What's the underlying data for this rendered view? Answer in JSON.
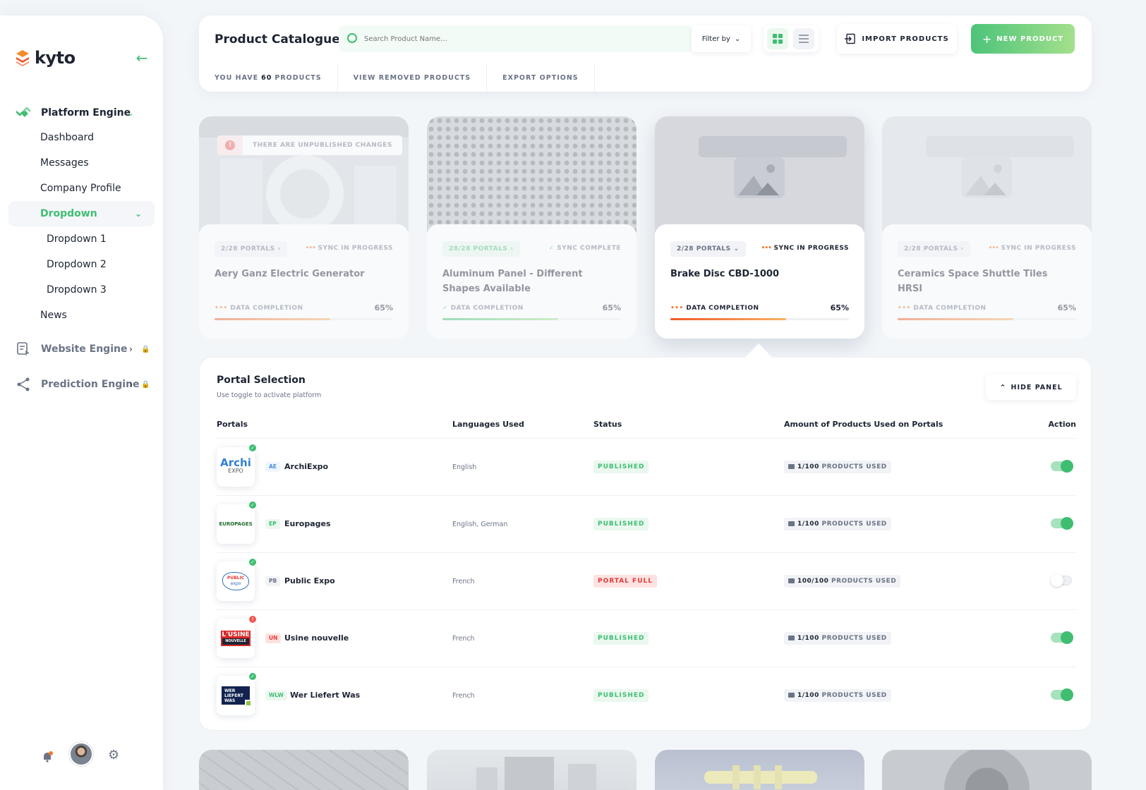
{
  "brand": {
    "name": "kyto"
  },
  "colors": {
    "accent": "#3fbe72",
    "orange": "#f07a2e",
    "danger": "#f25757"
  },
  "sidebar": {
    "sections": [
      {
        "label": "Platform Engine",
        "icon": "platform-engine-icon",
        "expanded": true
      },
      {
        "label": "Website Engine",
        "icon": "website-engine-icon",
        "locked": true
      },
      {
        "label": "Prediction Engine",
        "icon": "share-icon",
        "locked": true
      }
    ],
    "items": [
      "Dashboard",
      "Messages",
      "Company Profile",
      "Dropdown",
      "Dropdown 1",
      "Dropdown 2",
      "Dropdown 3",
      "News"
    ]
  },
  "topbar": {
    "title": "Product Catalogue",
    "search_placeholder": "Search Product Name...",
    "filter_label": "Filter by",
    "import_label": "IMPORT PRODUCTS",
    "new_label": "NEW PRODUCT",
    "tabs": {
      "count_prefix": "YOU HAVE",
      "count": "60",
      "count_suffix": "PRODUCTS",
      "removed": "VIEW REMOVED PRODUCTS",
      "export": "EXPORT OPTIONS"
    }
  },
  "cards": [
    {
      "portals": "2/28 PORTALS",
      "sync": "SYNC IN PROGRESS",
      "name": "Aery Ganz Electric Generator",
      "completion_label": "DATA COMPLETION",
      "completion": "65%",
      "alert": "THERE ARE UNPUBLISHED CHANGES"
    },
    {
      "portals": "28/28 PORTALS",
      "sync": "SYNC COMPLETE",
      "name": "Aluminum Panel - Different Shapes Available",
      "completion_label": "DATA COMPLETION",
      "completion": "65%"
    },
    {
      "portals": "2/28 PORTALS",
      "sync": "SYNC IN PROGRESS",
      "name": "Brake Disc CBD-1000",
      "completion_label": "DATA COMPLETION",
      "completion": "65%"
    },
    {
      "portals": "2/28 PORTALS",
      "sync": "SYNC IN PROGRESS",
      "name": "Ceramics Space Shuttle Tiles HRSI",
      "completion_label": "DATA COMPLETION",
      "completion": "65%"
    }
  ],
  "panel": {
    "title": "Portal Selection",
    "subtitle": "Use toggle to activate platform",
    "hide_label": "HIDE PANEL",
    "columns": {
      "portals": "Portals",
      "languages": "Languages Used",
      "status": "Status",
      "amount": "Amount of Products Used on Portals",
      "action": "Action"
    },
    "rows": [
      {
        "code": "AE",
        "name": "ArchiExpo",
        "languages": "English",
        "status": "PUBLISHED",
        "used": "1/100",
        "used_label": "PRODUCTS USED",
        "active": true
      },
      {
        "code": "EP",
        "name": "Europages",
        "languages": "English, German",
        "status": "PUBLISHED",
        "used": "1/100",
        "used_label": "PRODUCTS USED",
        "active": true
      },
      {
        "code": "PB",
        "name": "Public Expo",
        "languages": "French",
        "status": "PORTAL FULL",
        "used": "100/100",
        "used_label": "PRODUCTS USED",
        "active": false
      },
      {
        "code": "UN",
        "name": "Usine nouvelle",
        "languages": "French",
        "status": "PUBLISHED",
        "used": "1/100",
        "used_label": "PRODUCTS USED",
        "active": true
      },
      {
        "code": "WLW",
        "name": "Wer Liefert Was",
        "languages": "French",
        "status": "PUBLISHED",
        "used": "1/100",
        "used_label": "PRODUCTS USED",
        "active": true
      }
    ]
  },
  "logos": {
    "archiexpo": {
      "top": "Archi",
      "bottom": "EXPO"
    },
    "europages": "EUROPAGES",
    "publicexpo": {
      "top": "PUBLIC",
      "bottom": "expo"
    },
    "usine": {
      "top": "L'USINE",
      "bottom": "NOUVELLE"
    },
    "wlw": {
      "top": "WER",
      "middle": "LIEFERT",
      "bottom": "WAS"
    }
  }
}
